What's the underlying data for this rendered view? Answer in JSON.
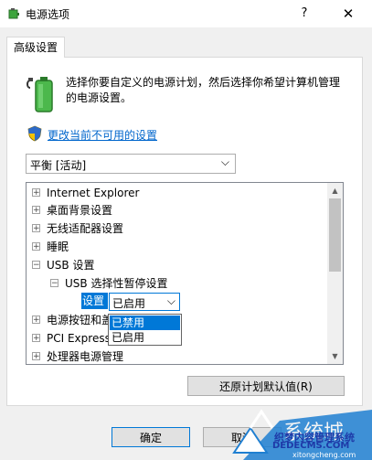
{
  "window": {
    "title": "电源选项",
    "help_glyph": "?",
    "close_glyph": "✕",
    "app_icon": "power-options-icon"
  },
  "tab": {
    "label": "高级设置"
  },
  "description": "选择你要自定义的电源计划，然后选择你希望计算机管理的电源设置。",
  "change_link": "更改当前不可用的设置",
  "plan_select": {
    "value": "平衡 [活动]",
    "chevron": "⌵"
  },
  "tree": {
    "items": [
      {
        "expander": "+",
        "label": "Internet Explorer"
      },
      {
        "expander": "+",
        "label": "桌面背景设置"
      },
      {
        "expander": "+",
        "label": "无线适配器设置"
      },
      {
        "expander": "+",
        "label": "睡眠"
      },
      {
        "expander": "−",
        "label": "USB 设置"
      },
      {
        "expander": "−",
        "label": "USB 选择性暂停设置"
      },
      {
        "expander": "+",
        "label": "电源按钮和盖"
      },
      {
        "expander": "+",
        "label": "PCI Express"
      },
      {
        "expander": "+",
        "label": "处理器电源管理"
      }
    ],
    "setting": {
      "label": "设置",
      "value": "已启用",
      "chevron": "⌵"
    },
    "dropdown_options": [
      "已禁用",
      "已启用"
    ],
    "scroll_up": "▲",
    "scroll_down": "▼"
  },
  "buttons": {
    "restore": "还原计划默认值(R)",
    "ok": "确定",
    "cancel": "取消"
  },
  "watermark": {
    "title": "系统城",
    "cn": "织梦内容管理系统",
    "domain": "DEDECMS.COM",
    "url": "xitongcheng.com"
  },
  "colors": {
    "accent": "#0078d7",
    "link": "#0066cc",
    "battery_green": "#3ca53c"
  }
}
